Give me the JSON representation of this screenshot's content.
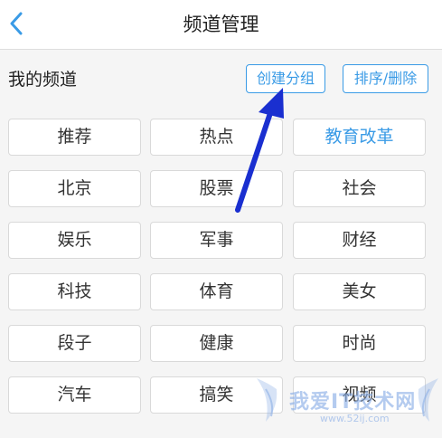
{
  "header": {
    "title": "频道管理",
    "back_icon": "chevron-left-icon"
  },
  "section": {
    "label": "我的频道"
  },
  "toolbar": {
    "create_group_label": "创建分组",
    "sort_delete_label": "排序/删除"
  },
  "channels": [
    {
      "label": "推荐",
      "highlighted": false
    },
    {
      "label": "热点",
      "highlighted": false
    },
    {
      "label": "教育改革",
      "highlighted": true
    },
    {
      "label": "北京",
      "highlighted": false
    },
    {
      "label": "股票",
      "highlighted": false
    },
    {
      "label": "社会",
      "highlighted": false
    },
    {
      "label": "娱乐",
      "highlighted": false
    },
    {
      "label": "军事",
      "highlighted": false
    },
    {
      "label": "财经",
      "highlighted": false
    },
    {
      "label": "科技",
      "highlighted": false
    },
    {
      "label": "体育",
      "highlighted": false
    },
    {
      "label": "美女",
      "highlighted": false
    },
    {
      "label": "段子",
      "highlighted": false
    },
    {
      "label": "健康",
      "highlighted": false
    },
    {
      "label": "时尚",
      "highlighted": false
    },
    {
      "label": "汽车",
      "highlighted": false
    },
    {
      "label": "搞笑",
      "highlighted": false
    },
    {
      "label": "视频",
      "highlighted": false
    }
  ],
  "watermark": {
    "text": "我爱IT技术网",
    "url": "www.52ij.com"
  },
  "colors": {
    "accent": "#3a9be6",
    "annotation_arrow": "#1a2fd0",
    "background": "#f5f5f5"
  }
}
